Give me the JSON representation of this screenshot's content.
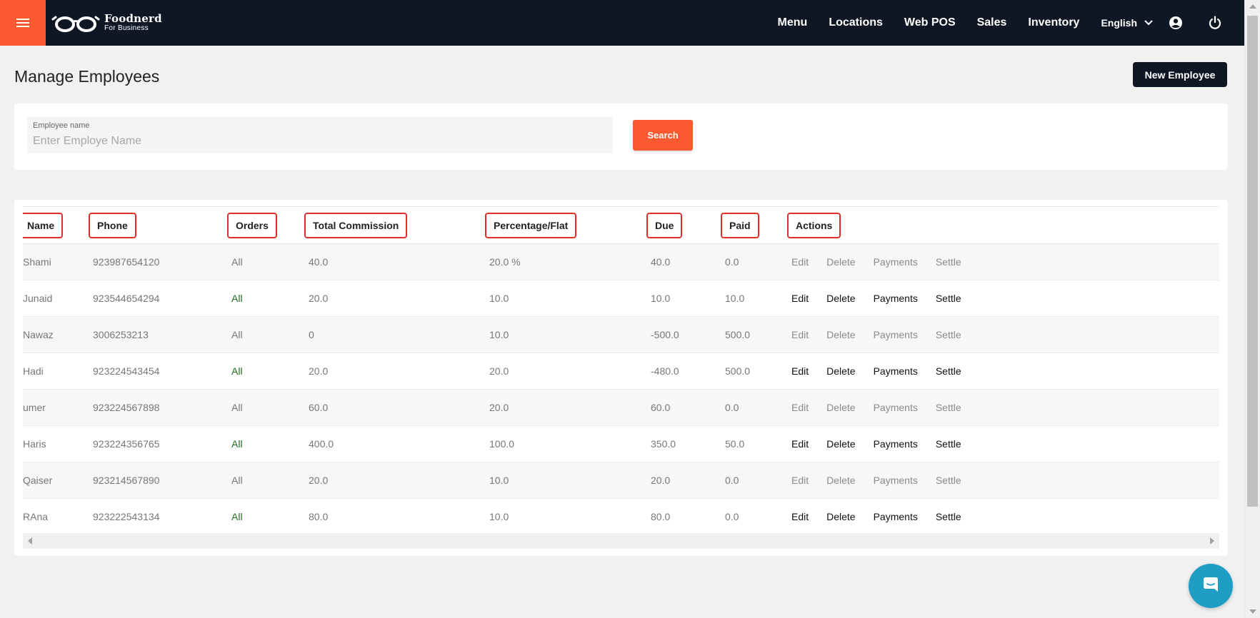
{
  "brand": {
    "title": "Foodnerd",
    "subtitle": "For Business"
  },
  "nav": {
    "items": [
      "Menu",
      "Locations",
      "Web POS",
      "Sales",
      "Inventory"
    ],
    "language": "English"
  },
  "page": {
    "title": "Manage Employees",
    "new_button": "New Employee"
  },
  "search": {
    "label": "Employee name",
    "placeholder": "Enter Employe Name",
    "value": "",
    "button": "Search"
  },
  "table": {
    "headers": [
      "Name",
      "Phone",
      "Orders",
      "Total Commission",
      "Percentage/Flat",
      "Due",
      "Paid",
      "Actions"
    ],
    "actions": [
      "Edit",
      "Delete",
      "Payments",
      "Settle"
    ],
    "rows": [
      {
        "name": "Shami",
        "phone": "923987654120",
        "orders": "All",
        "commission": "40.0",
        "pct": "20.0 %",
        "due": "40.0",
        "paid": "0.0"
      },
      {
        "name": "Junaid",
        "phone": "923544654294",
        "orders": "All",
        "commission": "20.0",
        "pct": "10.0",
        "due": "10.0",
        "paid": "10.0"
      },
      {
        "name": "Nawaz",
        "phone": "3006253213",
        "orders": "All",
        "commission": "0",
        "pct": "10.0",
        "due": "-500.0",
        "paid": "500.0"
      },
      {
        "name": "Hadi",
        "phone": "923224543454",
        "orders": "All",
        "commission": "20.0",
        "pct": "20.0",
        "due": "-480.0",
        "paid": "500.0"
      },
      {
        "name": "umer",
        "phone": "923224567898",
        "orders": "All",
        "commission": "60.0",
        "pct": "20.0",
        "due": "60.0",
        "paid": "0.0"
      },
      {
        "name": "Haris",
        "phone": "923224356765",
        "orders": "All",
        "commission": "400.0",
        "pct": "100.0",
        "due": "350.0",
        "paid": "50.0"
      },
      {
        "name": "Qaiser",
        "phone": "923214567890",
        "orders": "All",
        "commission": "20.0",
        "pct": "10.0",
        "due": "20.0",
        "paid": "0.0"
      },
      {
        "name": "RAna",
        "phone": "923222543134",
        "orders": "All",
        "commission": "80.0",
        "pct": "10.0",
        "due": "80.0",
        "paid": "0.0"
      }
    ]
  },
  "colors": {
    "accent": "#fb5a30",
    "navbar": "#0f1624",
    "highlight": "#e0302c",
    "chat": "#1e9ec4"
  },
  "icons": {
    "menu": "hamburger-icon",
    "account": "account-circle-icon",
    "power": "power-icon",
    "chat": "chat-icon"
  }
}
